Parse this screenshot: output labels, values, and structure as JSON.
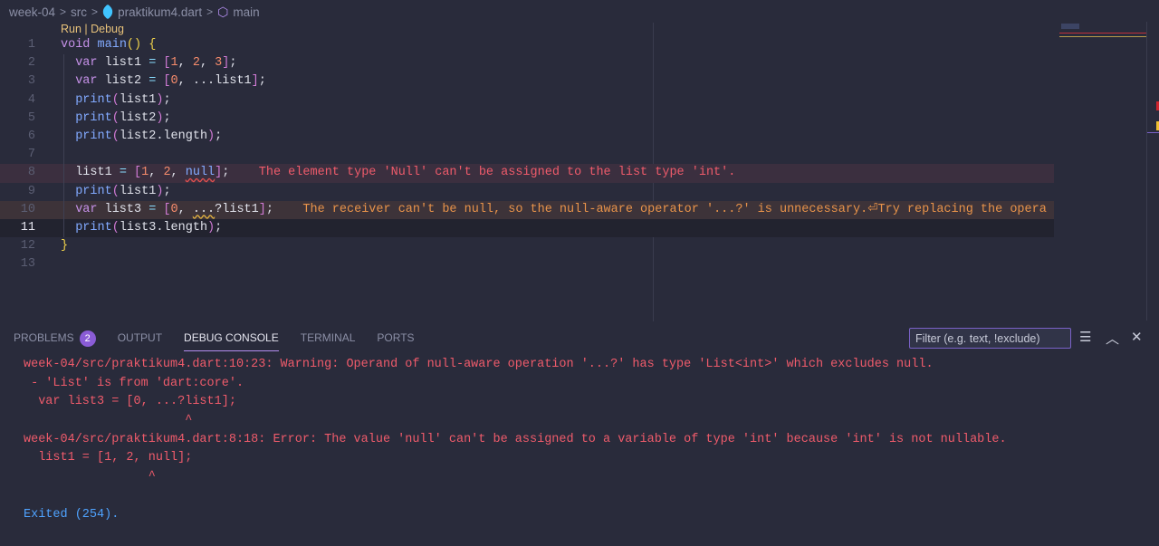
{
  "breadcrumb": [
    "week-04",
    "src",
    "praktikum4.dart",
    "main"
  ],
  "codelens": "Run | Debug",
  "code": [
    {
      "n": "1",
      "t": [
        [
          "void ",
          "kw"
        ],
        [
          "main",
          "fn"
        ],
        [
          "()",
          "br1"
        ],
        [
          " ",
          ""
        ],
        [
          "{",
          "br1"
        ]
      ]
    },
    {
      "n": "2",
      "t": [
        [
          "  var ",
          "kw"
        ],
        [
          "list1 ",
          ""
        ],
        [
          "= ",
          "p"
        ],
        [
          "[",
          "br"
        ],
        [
          "1",
          "num"
        ],
        [
          ", ",
          ""
        ],
        [
          "2",
          "num"
        ],
        [
          ", ",
          ""
        ],
        [
          "3",
          "num"
        ],
        [
          "]",
          "br"
        ],
        [
          ";",
          ""
        ]
      ]
    },
    {
      "n": "3",
      "t": [
        [
          "  var ",
          "kw"
        ],
        [
          "list2 ",
          ""
        ],
        [
          "= ",
          "p"
        ],
        [
          "[",
          "br"
        ],
        [
          "0",
          "num"
        ],
        [
          ", ...list1",
          ""
        ],
        [
          "]",
          "br"
        ],
        [
          ";",
          ""
        ]
      ]
    },
    {
      "n": "4",
      "t": [
        [
          "  print",
          "fn"
        ],
        [
          "(",
          "br"
        ],
        [
          "list1",
          ""
        ],
        [
          ")",
          "br"
        ],
        [
          ";",
          ""
        ]
      ]
    },
    {
      "n": "5",
      "t": [
        [
          "  print",
          "fn"
        ],
        [
          "(",
          "br"
        ],
        [
          "list2",
          ""
        ],
        [
          ")",
          "br"
        ],
        [
          ";",
          ""
        ]
      ]
    },
    {
      "n": "6",
      "t": [
        [
          "  print",
          "fn"
        ],
        [
          "(",
          "br"
        ],
        [
          "list2.length",
          ""
        ],
        [
          ")",
          "br"
        ],
        [
          ";",
          ""
        ]
      ]
    },
    {
      "n": "7",
      "t": []
    },
    {
      "n": "8",
      "cls": "err",
      "t": [
        [
          "  list1 ",
          ""
        ],
        [
          "= ",
          "p"
        ],
        [
          "[",
          "br"
        ],
        [
          "1",
          "num"
        ],
        [
          ", ",
          ""
        ],
        [
          "2",
          "num"
        ],
        [
          ", ",
          ""
        ],
        [
          "null",
          "fn sqr"
        ],
        [
          "]",
          "br"
        ],
        [
          ";",
          ""
        ],
        [
          "    The element type 'Null' can't be assigned to the list type 'int'.",
          "diag-err"
        ]
      ]
    },
    {
      "n": "9",
      "t": [
        [
          "  print",
          "fn"
        ],
        [
          "(",
          "br"
        ],
        [
          "list1",
          ""
        ],
        [
          ")",
          "br"
        ],
        [
          ";",
          ""
        ]
      ]
    },
    {
      "n": "10",
      "cls": "warn",
      "t": [
        [
          "  var ",
          "kw"
        ],
        [
          "list3 ",
          ""
        ],
        [
          "= ",
          "p"
        ],
        [
          "[",
          "br"
        ],
        [
          "0",
          "num"
        ],
        [
          ", ",
          ""
        ],
        [
          "...",
          "sqy"
        ],
        [
          "?list1",
          ""
        ],
        [
          "]",
          "br"
        ],
        [
          ";",
          ""
        ],
        [
          "    The receiver can't be null, so the null-aware operator '...?' is unnecessary.⏎Try replacing the opera",
          "diag-warn"
        ]
      ]
    },
    {
      "n": "11",
      "cls": "cur",
      "active": true,
      "t": [
        [
          "  print",
          "fn"
        ],
        [
          "(",
          "br"
        ],
        [
          "list3.length",
          ""
        ],
        [
          ")",
          "br"
        ],
        [
          ";",
          ""
        ]
      ]
    },
    {
      "n": "12",
      "t": [
        [
          "}",
          "br1"
        ]
      ]
    },
    {
      "n": "13",
      "t": []
    }
  ],
  "panel": {
    "tabs": [
      "PROBLEMS",
      "OUTPUT",
      "DEBUG CONSOLE",
      "TERMINAL",
      "PORTS"
    ],
    "problems_count": "2",
    "filter_placeholder": "Filter (e.g. text, !exclude)",
    "console": [
      "week-04/src/praktikum4.dart:10:23: Warning: Operand of null-aware operation '...?' has type 'List<int>' which excludes null.",
      " - 'List' is from 'dart:core'.",
      "  var list3 = [0, ...?list1];",
      "                      ^",
      "week-04/src/praktikum4.dart:8:18: Error: The value 'null' can't be assigned to a variable of type 'int' because 'int' is not nullable.",
      "  list1 = [1, 2, null];",
      "                 ^",
      "",
      "Exited (254)."
    ]
  }
}
